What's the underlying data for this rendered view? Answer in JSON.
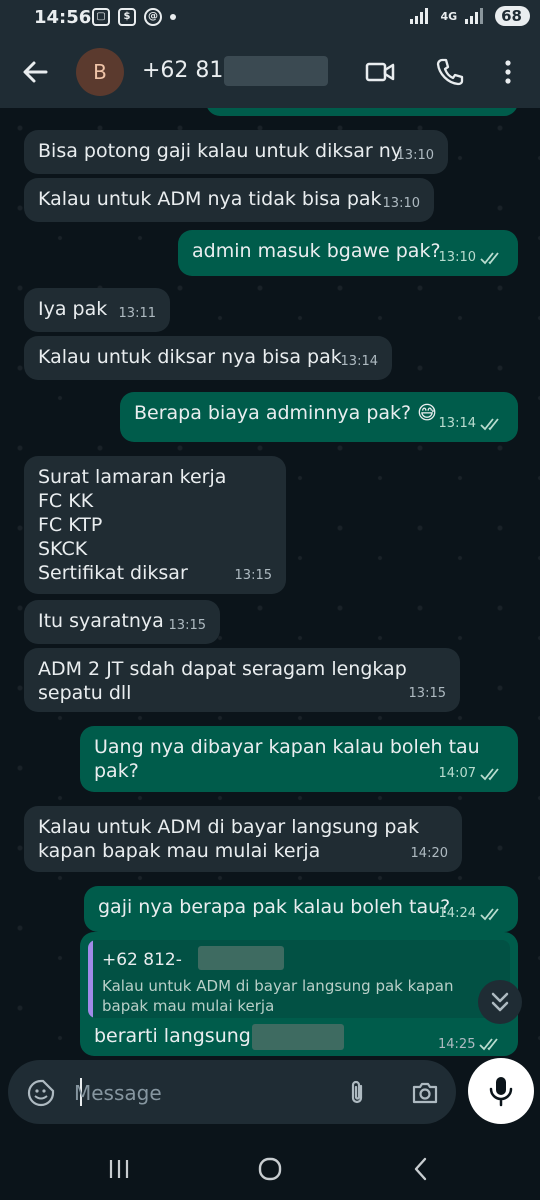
{
  "status_bar": {
    "time": "14:56",
    "network": "4G",
    "battery": "68"
  },
  "header": {
    "avatar_letter": "B",
    "contact_name": "+62 812-"
  },
  "messages": [
    {
      "dir": "in",
      "text": "Bisa potong gaji kalau untuk diksar ny",
      "time": "13:10"
    },
    {
      "dir": "in",
      "text": "Kalau untuk ADM nya tidak bisa pak",
      "time": "13:10"
    },
    {
      "dir": "out",
      "text": "admin masuk bgawe pak?",
      "time": "13:10"
    },
    {
      "dir": "in",
      "text": "Iya pak",
      "time": "13:11"
    },
    {
      "dir": "in",
      "text": "Kalau untuk diksar nya bisa pak",
      "time": "13:14"
    },
    {
      "dir": "out",
      "text": "Berapa biaya adminnya pak?",
      "emoji": "😅",
      "time": "13:14"
    },
    {
      "dir": "in",
      "text": "Surat lamaran kerja\nFC KK\nFC KTP\nSKCK\nSertifikat diksar",
      "time": "13:15"
    },
    {
      "dir": "in",
      "text": "Itu syaratnya",
      "time": "13:15"
    },
    {
      "dir": "in",
      "text": "ADM 2 JT sdah dapat seragam lengkap\nsepatu dll",
      "time": "13:15"
    },
    {
      "dir": "out",
      "text": "Uang nya dibayar kapan kalau boleh tau\npak?",
      "time": "14:07"
    },
    {
      "dir": "in",
      "text": "Kalau untuk ADM di bayar langsung pak\nkapan bapak mau mulai kerja",
      "time": "14:20"
    },
    {
      "dir": "out",
      "text": "gaji nya berapa pak kalau boleh tau?",
      "time": "14:24"
    },
    {
      "dir": "out",
      "text": "berarti langsung l",
      "time": "14:25",
      "quote": {
        "author": "+62 812-",
        "text": "Kalau untuk ADM di bayar langsung pak kapan bapak mau mulai kerja"
      }
    }
  ],
  "composer": {
    "placeholder": "Message"
  },
  "colors": {
    "incoming": "#202c33",
    "outgoing": "#005c4b",
    "header": "#1f2c34",
    "background": "#0b141a",
    "quote_bar": "#a08ae8"
  }
}
